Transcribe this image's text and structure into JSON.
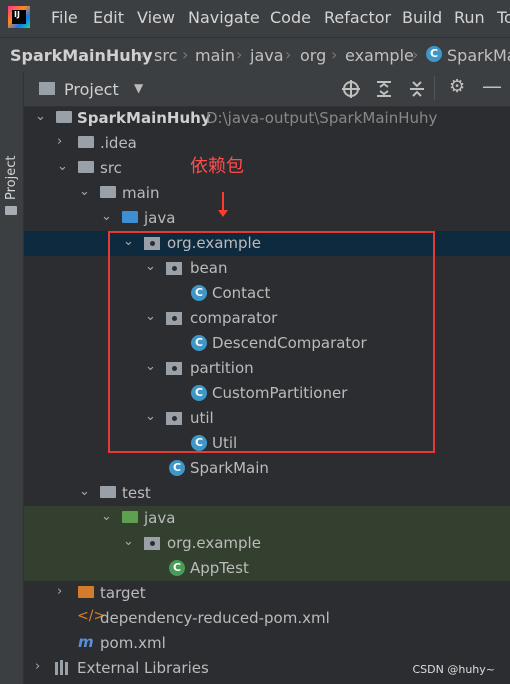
{
  "menu": [
    "File",
    "Edit",
    "View",
    "Navigate",
    "Code",
    "Refactor",
    "Build",
    "Run",
    "To"
  ],
  "breadcrumbs": [
    "SparkMainHuhy",
    "src",
    "main",
    "java",
    "org",
    "example",
    "SparkMa"
  ],
  "panel": {
    "title": "Project",
    "left_tab": "Project"
  },
  "tree": {
    "root": {
      "name": "SparkMainHuhy",
      "path": "D:\\java-output\\SparkMainHuhy"
    },
    "idea": ".idea",
    "src": "src",
    "main": "main",
    "java": "java",
    "org_example": "org.example",
    "bean": "bean",
    "contact": "Contact",
    "comparator": "comparator",
    "descend": "DescendComparator",
    "partition": "partition",
    "custom": "CustomPartitioner",
    "util": "util",
    "util_cls": "Util",
    "sparkmain": "SparkMain",
    "test": "test",
    "test_java": "java",
    "test_org": "org.example",
    "apptest": "AppTest",
    "target": "target",
    "dep_pom": "dependency-reduced-pom.xml",
    "pom": "pom.xml",
    "ext_libs": "External Libraries"
  },
  "annotation": "依赖包",
  "watermark": "CSDN @huhy~",
  "colors": {
    "selected_row": "#0e2a3f",
    "test_rows": "#34402f",
    "annotation": "#e53935"
  }
}
